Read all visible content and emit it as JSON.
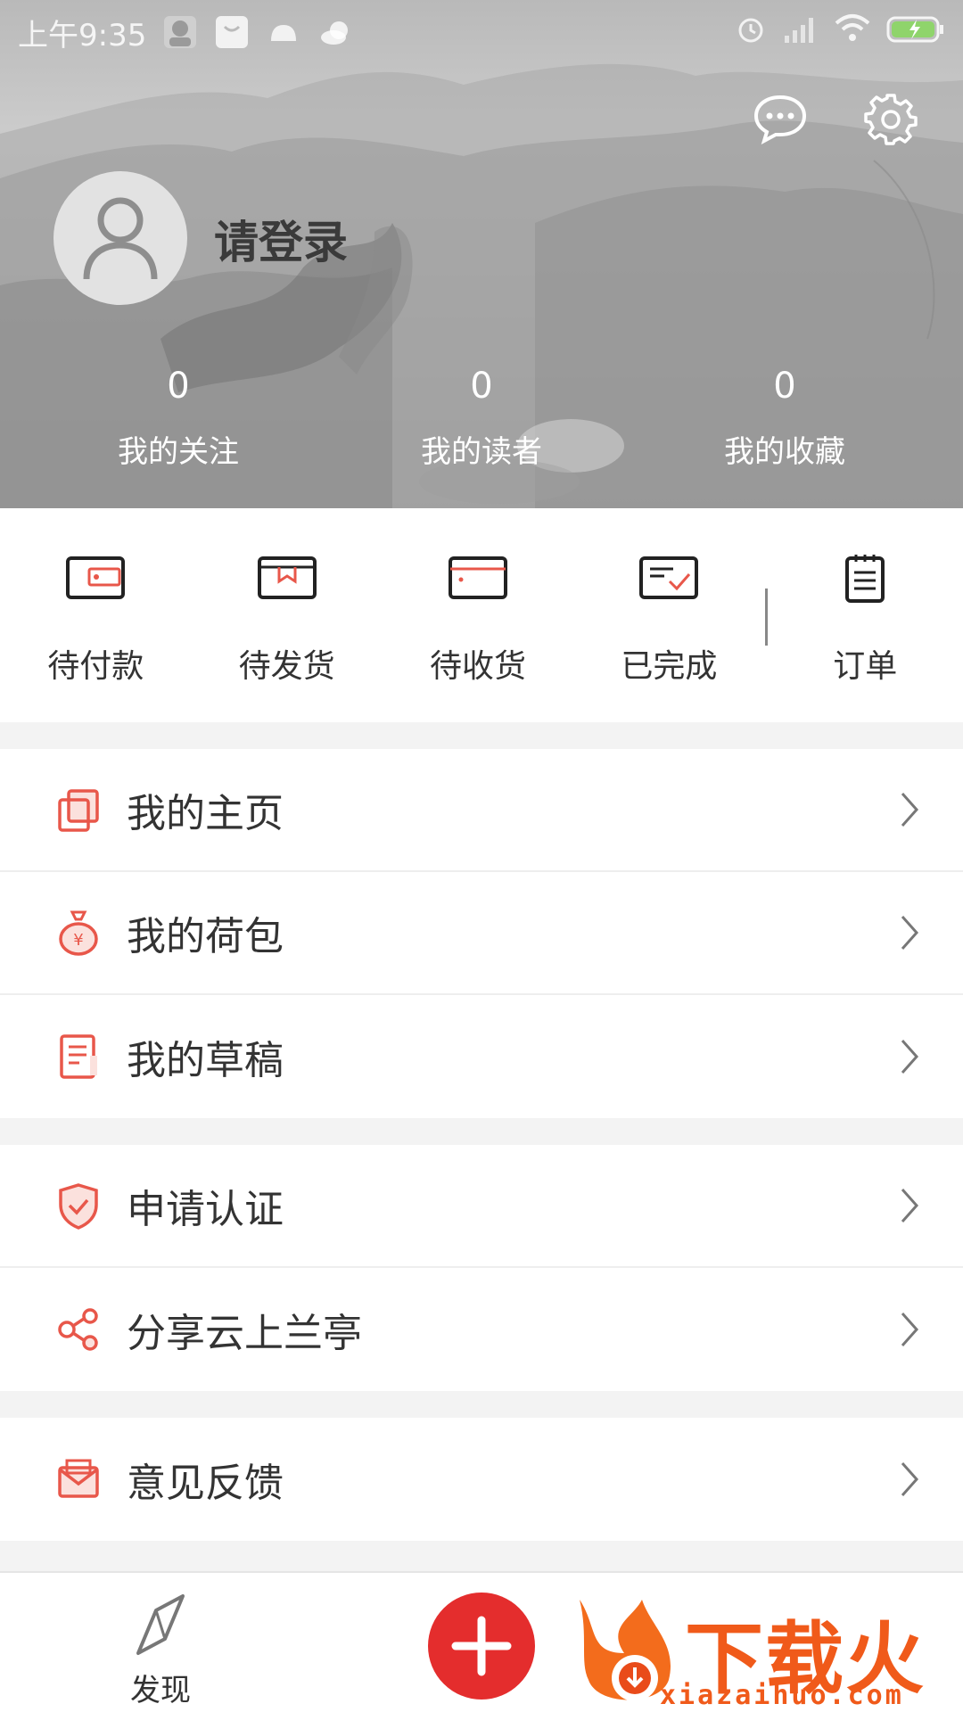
{
  "status_bar": {
    "time": "上午9:35",
    "icons": [
      "avatar-notification-icon",
      "shopping-bag-icon",
      "android-icon",
      "cloud-icon",
      "alarm-icon",
      "signal-icon",
      "wifi-icon",
      "battery-charging-icon"
    ]
  },
  "header": {
    "actions": [
      "message-icon",
      "settings-icon"
    ],
    "login_text": "请登录",
    "stats": [
      {
        "count": "0",
        "label": "我的关注"
      },
      {
        "count": "0",
        "label": "我的读者"
      },
      {
        "count": "0",
        "label": "我的收藏"
      }
    ]
  },
  "orders": {
    "items": [
      {
        "label": "待付款",
        "icon": "wallet-icon"
      },
      {
        "label": "待发货",
        "icon": "box-icon"
      },
      {
        "label": "待收货",
        "icon": "card-icon"
      },
      {
        "label": "已完成",
        "icon": "check-doc-icon"
      }
    ],
    "all": {
      "label": "订单",
      "icon": "order-list-icon"
    }
  },
  "menu": {
    "group1": [
      {
        "label": "我的主页",
        "icon": "pages-icon"
      },
      {
        "label": "我的荷包",
        "icon": "money-bag-icon"
      },
      {
        "label": "我的草稿",
        "icon": "draft-icon"
      }
    ],
    "group2": [
      {
        "label": "申请认证",
        "icon": "shield-check-icon"
      },
      {
        "label": "分享云上兰亭",
        "icon": "share-icon"
      }
    ],
    "group3": [
      {
        "label": "意见反馈",
        "icon": "mail-icon"
      }
    ]
  },
  "bottom_nav": {
    "discover_label": "发现",
    "add_icon": "plus-icon",
    "watermark_cn": "下载火",
    "watermark_en": "xiazaihuo.com"
  },
  "colors": {
    "accent": "#e42d2d",
    "icon_red": "#e8574a",
    "watermark": "#f05a1a"
  }
}
